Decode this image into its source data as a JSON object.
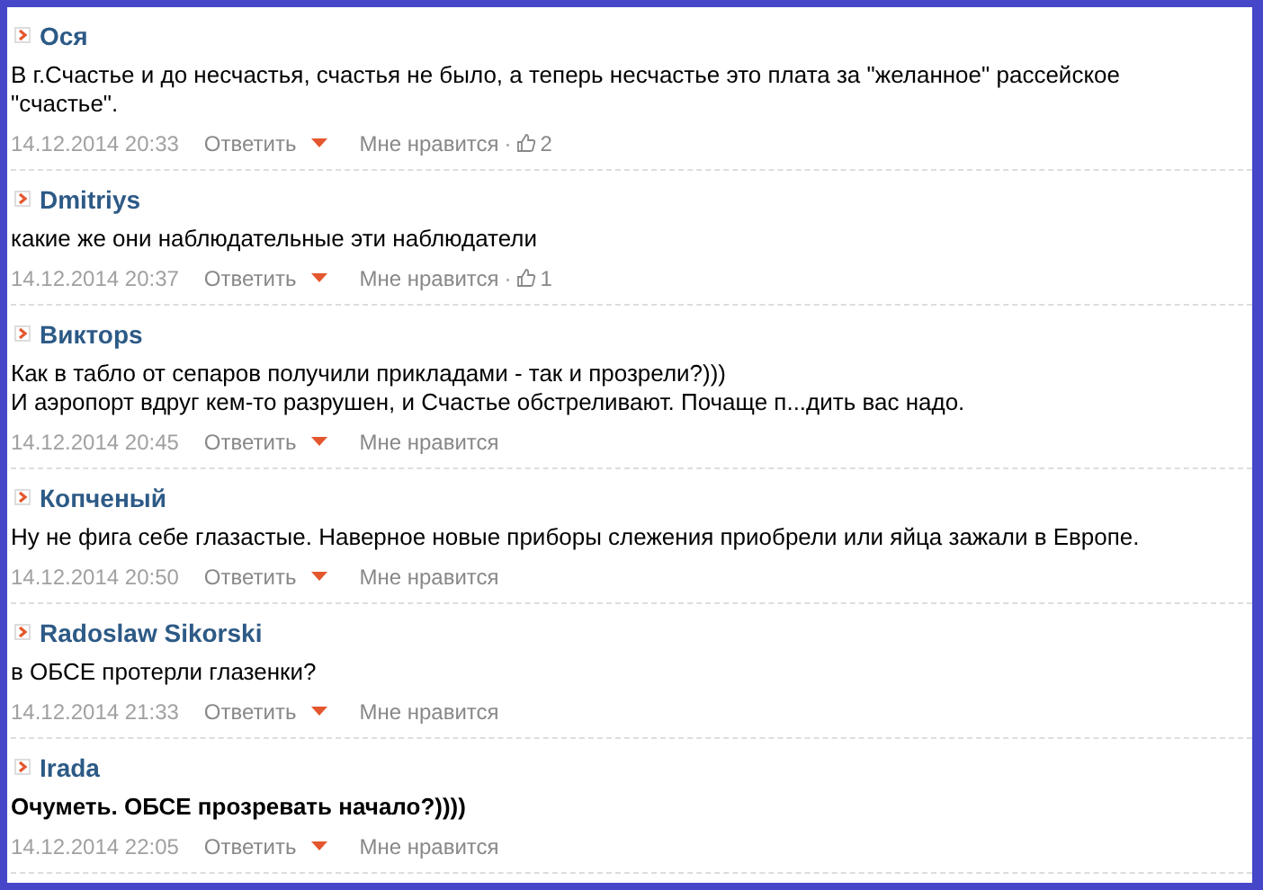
{
  "comments": [
    {
      "author": "Ося",
      "text": "В г.Счастье и до несчастья, счастья не было, а теперь несчастье это плата за \"желанное\" рассейское \"счастье\".",
      "bold": false,
      "date": "14.12.2014 20:33",
      "reply": "Ответить",
      "like": "Мне нравится",
      "separator": "·",
      "likes": "2"
    },
    {
      "author": "Dmitriys",
      "text": "какие же они наблюдательные эти наблюдатели",
      "bold": false,
      "date": "14.12.2014 20:37",
      "reply": "Ответить",
      "like": "Мне нравится",
      "separator": "·",
      "likes": "1"
    },
    {
      "author": "Викторs",
      "text": "Как в табло от сепаров получили прикладами - так и прозрели?)))\nИ аэропорт вдруг кем-то разрушен, и Счастье обстреливают. Почаще п...дить вас надо.",
      "bold": false,
      "date": "14.12.2014 20:45",
      "reply": "Ответить",
      "like": "Мне нравится"
    },
    {
      "author": "Копченый",
      "text": "Ну не фига себе глазастые. Наверное новые приборы слежения приобрели или яйца зажали в Европе.",
      "bold": false,
      "date": "14.12.2014 20:50",
      "reply": "Ответить",
      "like": "Мне нравится"
    },
    {
      "author": "Radoslaw Sikorski",
      "text": "в ОБСЕ протерли глазенки?",
      "bold": false,
      "date": "14.12.2014 21:33",
      "reply": "Ответить",
      "like": "Мне нравится"
    },
    {
      "author": "Irada",
      "text": "Очуметь. ОБСЕ прозревать начало?))))",
      "bold": true,
      "date": "14.12.2014 22:05",
      "reply": "Ответить",
      "like": "Мне нравится"
    }
  ]
}
